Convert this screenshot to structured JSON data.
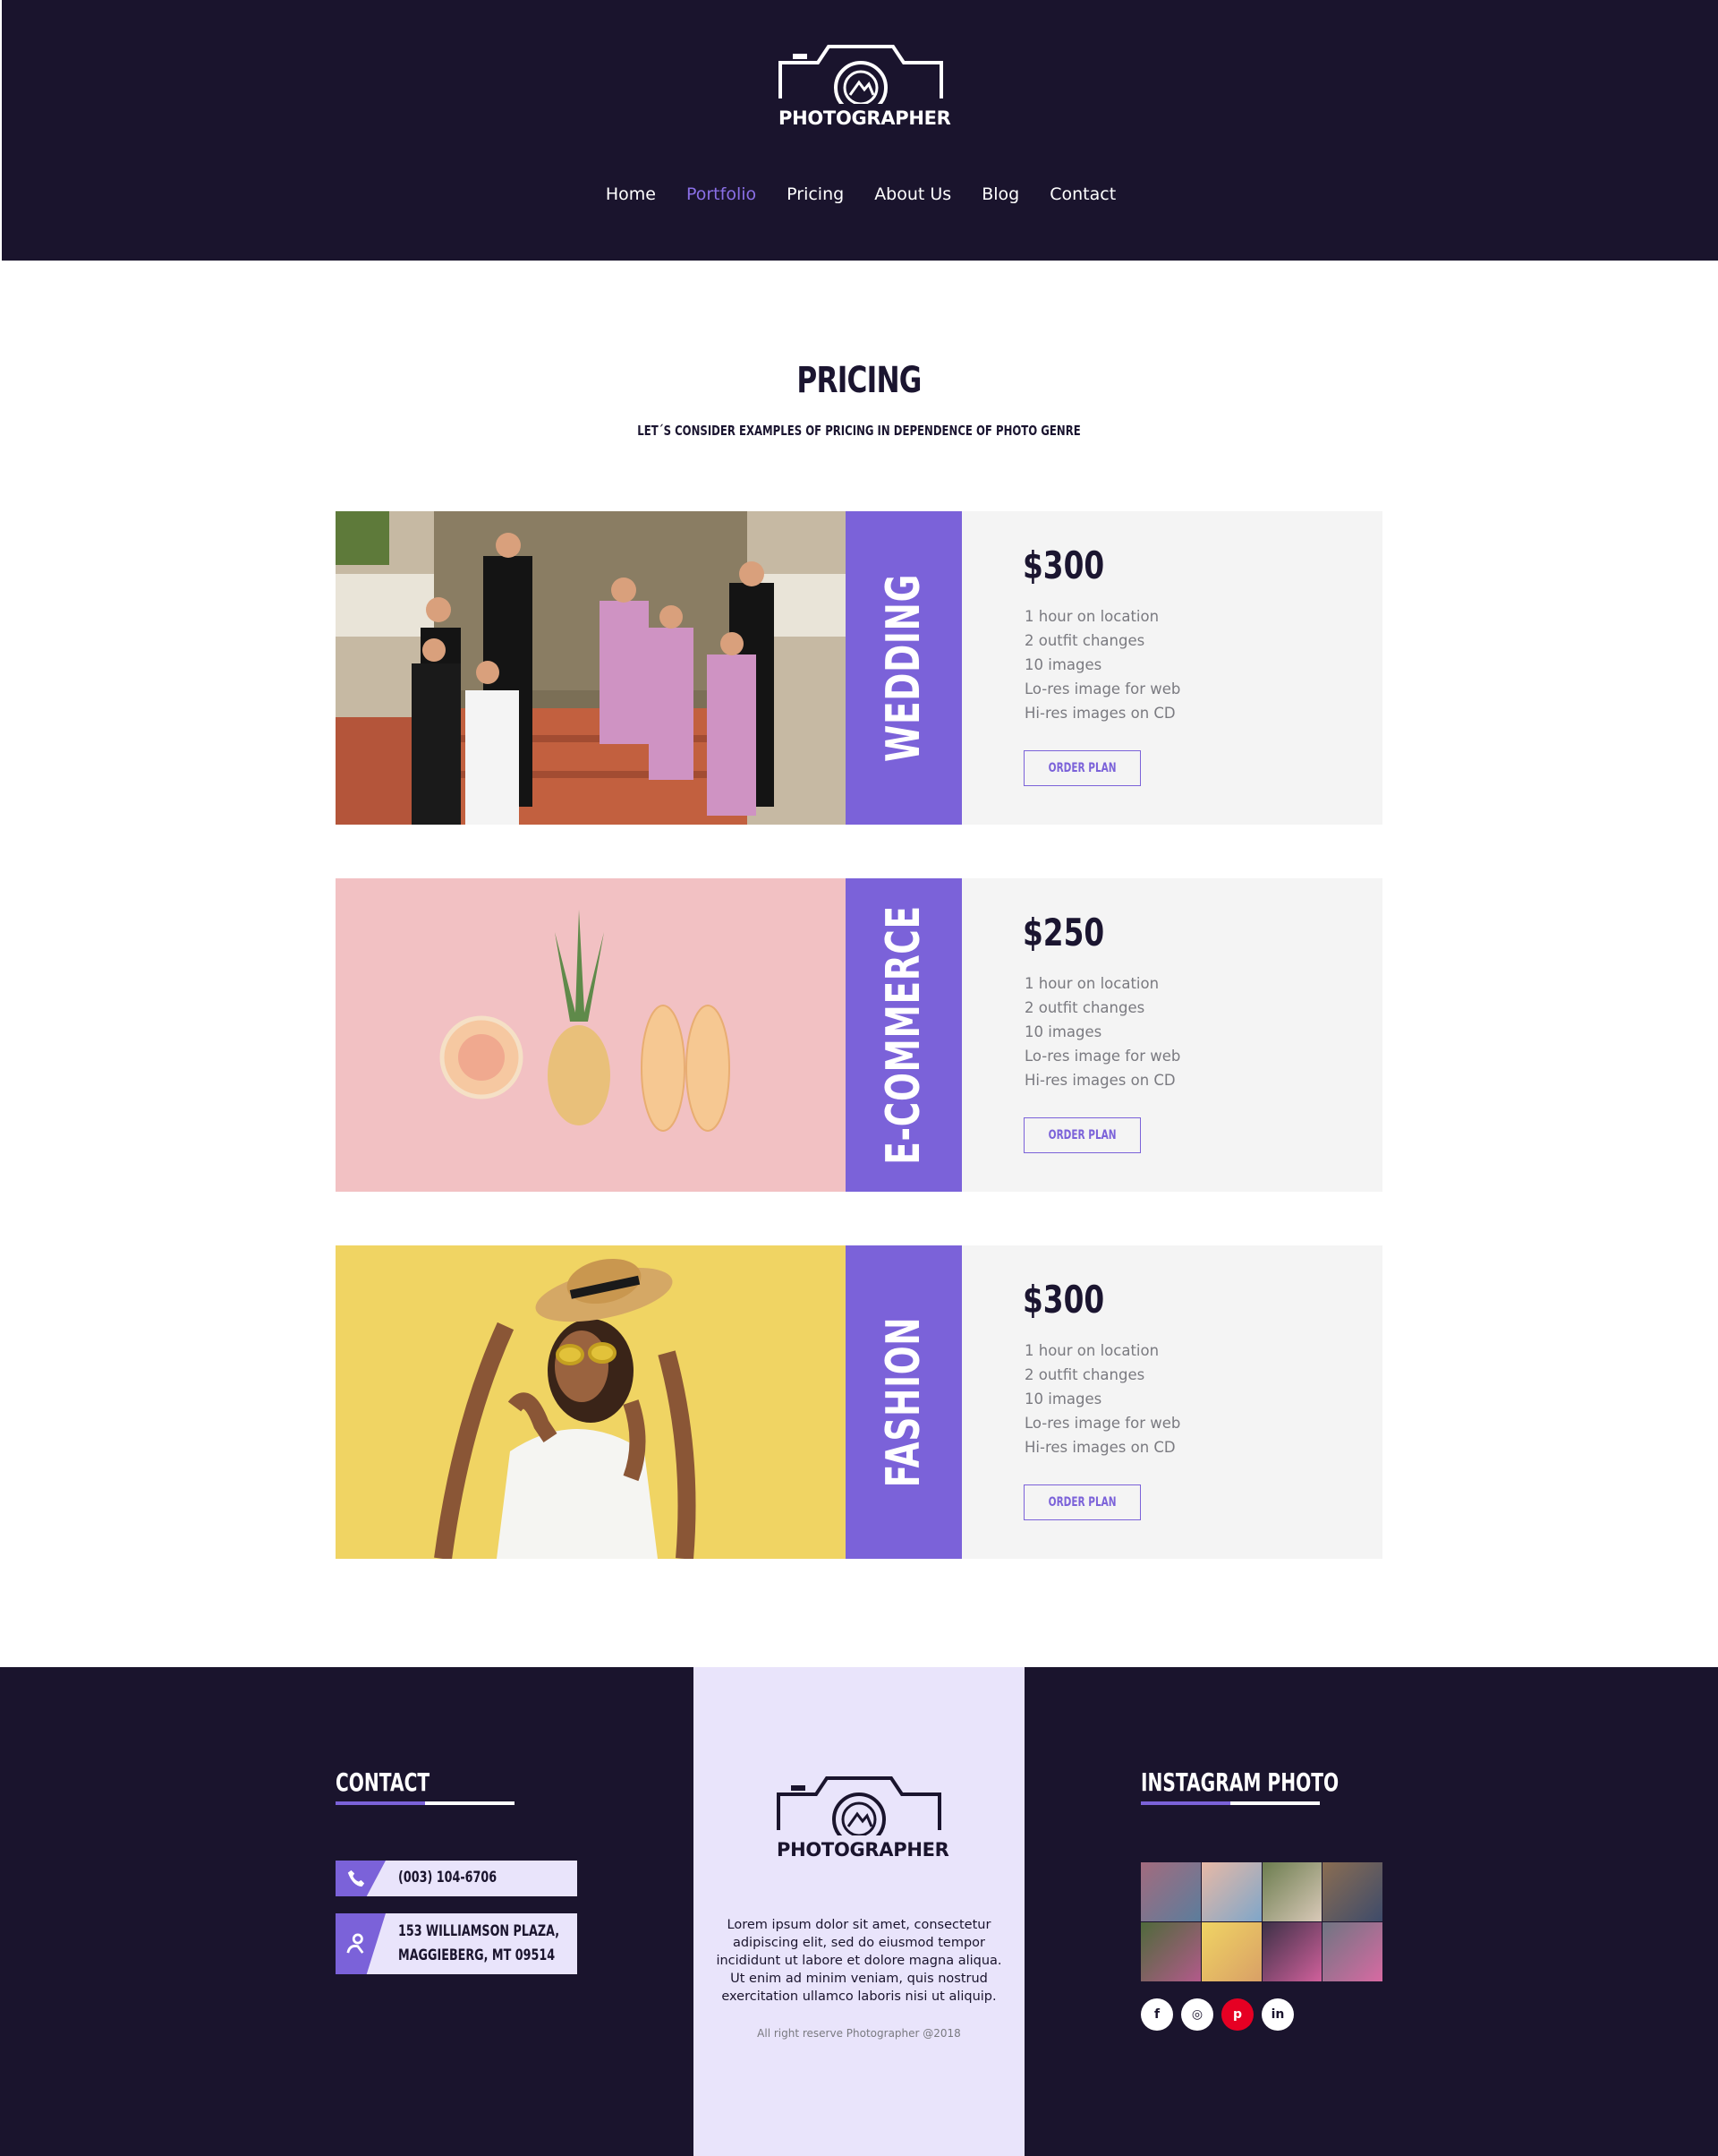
{
  "header": {
    "brand": "PHOTOGRAPHER",
    "nav": [
      {
        "label": "Home"
      },
      {
        "label": "Portfolio"
      },
      {
        "label": "Pricing"
      },
      {
        "label": "About Us"
      },
      {
        "label": "Blog"
      },
      {
        "label": "Contact"
      }
    ],
    "active_nav": "Portfolio"
  },
  "pricing": {
    "title": "PRICING",
    "subtitle": "LET´S CONSIDER EXAMPLES OF PRICING IN DEPENDENCE OF PHOTO GENRE",
    "plans": [
      {
        "genre": "WEDDING",
        "price": "$300",
        "features": [
          "1 hour on location",
          "2 outfit changes",
          "10 images",
          "Lo-res image for web",
          "Hi-res images on CD"
        ],
        "button": "ORDER PLAN"
      },
      {
        "genre": "E-COMMERCE",
        "price": "$250",
        "features": [
          "1 hour on location",
          "2 outfit changes",
          "10 images",
          "Lo-res image for web",
          "Hi-res images on CD"
        ],
        "button": "ORDER PLAN"
      },
      {
        "genre": "FASHION",
        "price": "$300",
        "features": [
          "1 hour on location",
          "2 outfit changes",
          "10 images",
          "Lo-res image for web",
          "Hi-res images on CD"
        ],
        "button": "ORDER PLAN"
      }
    ]
  },
  "footer": {
    "contact": {
      "heading": "CONTACT",
      "phone": "(003) 104-6706",
      "address_line1": "153 WILLIAMSON PLAZA,",
      "address_line2": "MAGGIEBERG, MT 09514"
    },
    "brand": "PHOTOGRAPHER",
    "lorem": "Lorem ipsum dolor sit amet, consectetur adipiscing elit, sed do eiusmod tempor incididunt ut labore et dolore magna aliqua. Ut enim ad minim veniam, quis nostrud exercitation ullamco laboris nisi ut aliquip.",
    "copyright": "All right reserve Photographer @2018",
    "instagram": {
      "heading": "INSTAGRAM PHOTO"
    },
    "socials": [
      {
        "icon": "facebook-icon",
        "glyph": "f"
      },
      {
        "icon": "instagram-icon",
        "glyph": "◎"
      },
      {
        "icon": "pinterest-icon",
        "glyph": "p"
      },
      {
        "icon": "linkedin-icon",
        "glyph": "in"
      }
    ]
  },
  "colors": {
    "dark": "#1a142d",
    "accent": "#7b62d9",
    "lavender": "#e9e4fb"
  }
}
